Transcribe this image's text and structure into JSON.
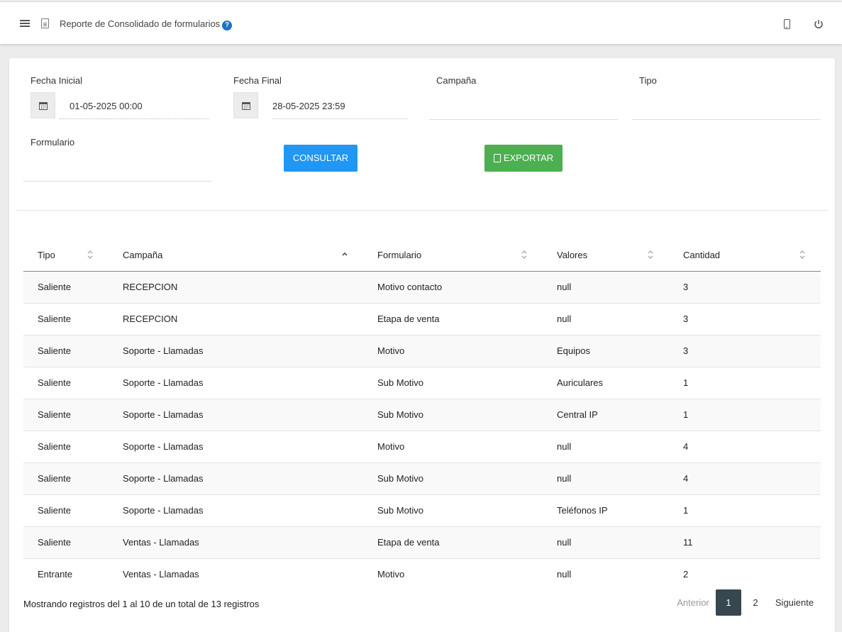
{
  "header": {
    "title": "Reporte de Consolidado de formularios",
    "help": "?",
    "icons": [
      "menu-icon",
      "report-icon",
      "help-icon",
      "phone-icon",
      "power-icon"
    ]
  },
  "filters": {
    "fecha_inicial": {
      "label": "Fecha Inicial",
      "value": "01-05-2025 00:00"
    },
    "fecha_final": {
      "label": "Fecha Final",
      "value": "28-05-2025 23:59"
    },
    "campana": {
      "label": "Campaña",
      "value": ""
    },
    "tipo": {
      "label": "Tipo",
      "value": ""
    },
    "formulario": {
      "label": "Formulario",
      "value": ""
    }
  },
  "actions": {
    "consultar": "CONSULTAR",
    "exportar": "EXPORTAR"
  },
  "table": {
    "columns": [
      "Tipo",
      "Campaña",
      "Formulario",
      "Valores",
      "Cantidad"
    ],
    "rows": [
      [
        "Saliente",
        "RECEPCION",
        "Motivo contacto",
        "null",
        "3"
      ],
      [
        "Saliente",
        "RECEPCION",
        "Etapa de venta",
        "null",
        "3"
      ],
      [
        "Saliente",
        "Soporte - Llamadas",
        "Motivo",
        "Equipos",
        "3"
      ],
      [
        "Saliente",
        "Soporte - Llamadas",
        "Sub Motivo",
        "Auriculares",
        "1"
      ],
      [
        "Saliente",
        "Soporte - Llamadas",
        "Sub Motivo",
        "Central IP",
        "1"
      ],
      [
        "Saliente",
        "Soporte - Llamadas",
        "Motivo",
        "null",
        "4"
      ],
      [
        "Saliente",
        "Soporte - Llamadas",
        "Sub Motivo",
        "null",
        "4"
      ],
      [
        "Saliente",
        "Soporte - Llamadas",
        "Sub Motivo",
        "Teléfonos IP",
        "1"
      ],
      [
        "Saliente",
        "Ventas - Llamadas",
        "Etapa de venta",
        "null",
        "11"
      ],
      [
        "Entrante",
        "Ventas - Llamadas",
        "Motivo",
        "null",
        "2"
      ]
    ]
  },
  "pagination": {
    "info": "Mostrando registros del 1 al 10 de un total de 13 registros",
    "prev": "Anterior",
    "pages": [
      "1",
      "2"
    ],
    "next": "Siguiente"
  },
  "colors": {
    "primary": "#2196f3",
    "success": "#4caf50",
    "active_page": "#37474f",
    "help": "#1a73c8"
  }
}
